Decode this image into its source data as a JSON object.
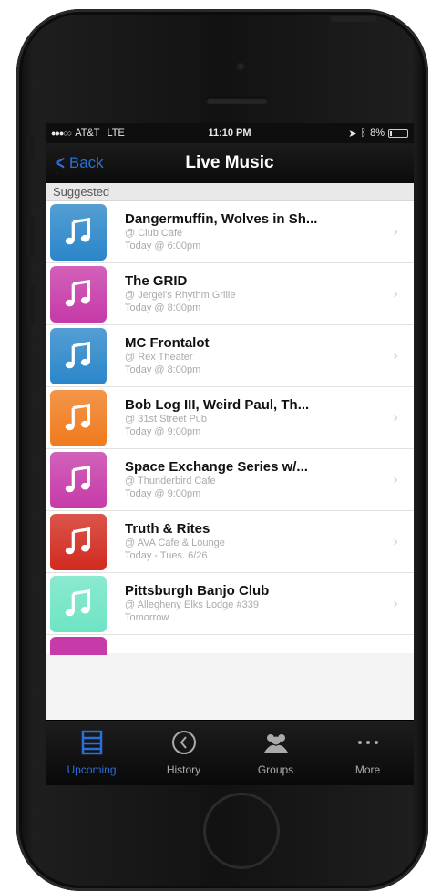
{
  "status_bar": {
    "carrier": "AT&T",
    "network": "LTE",
    "time": "11:10 PM",
    "battery": "8%",
    "battery_level": 0.08
  },
  "nav": {
    "back_label": "Back",
    "title": "Live Music"
  },
  "section_header": "Suggested",
  "events": [
    {
      "title": "Dangermuffin, Wolves in Sh...",
      "venue": "@ Club Cafe",
      "when": "Today @ 6:00pm",
      "color": "#2a86c9"
    },
    {
      "title": "The GRID",
      "venue": "@ Jergel's Rhythm Grille",
      "when": "Today @ 8:00pm",
      "color": "#c63aa9"
    },
    {
      "title": "MC Frontalot",
      "venue": "@ Rex Theater",
      "when": "Today @ 8:00pm",
      "color": "#2a86c9"
    },
    {
      "title": "Bob Log III, Weird Paul, Th...",
      "venue": "@ 31st Street Pub",
      "when": "Today @ 9:00pm",
      "color": "#f07b1d"
    },
    {
      "title": "Space Exchange Series w/...",
      "venue": "@ Thunderbird Cafe",
      "when": "Today @ 9:00pm",
      "color": "#c63aa9"
    },
    {
      "title": "Truth & Rites",
      "venue": "@ AVA Cafe & Lounge",
      "when": "Today - Tues. 6/26",
      "color": "#d22a1e"
    },
    {
      "title": "Pittsburgh Banjo Club",
      "venue": "@ Allegheny Elks Lodge #339",
      "when": "Tomorrow",
      "color": "#6ee4c4"
    }
  ],
  "partial_row_color": "#c63aa9",
  "tabs": [
    {
      "label": "Upcoming",
      "icon": "list-icon",
      "active": true
    },
    {
      "label": "History",
      "icon": "clock-icon",
      "active": false
    },
    {
      "label": "Groups",
      "icon": "people-icon",
      "active": false
    },
    {
      "label": "More",
      "icon": "more-dots-icon",
      "active": false
    }
  ],
  "colors": {
    "accent": "#2a6fd8",
    "nav_bg": "#111111"
  }
}
